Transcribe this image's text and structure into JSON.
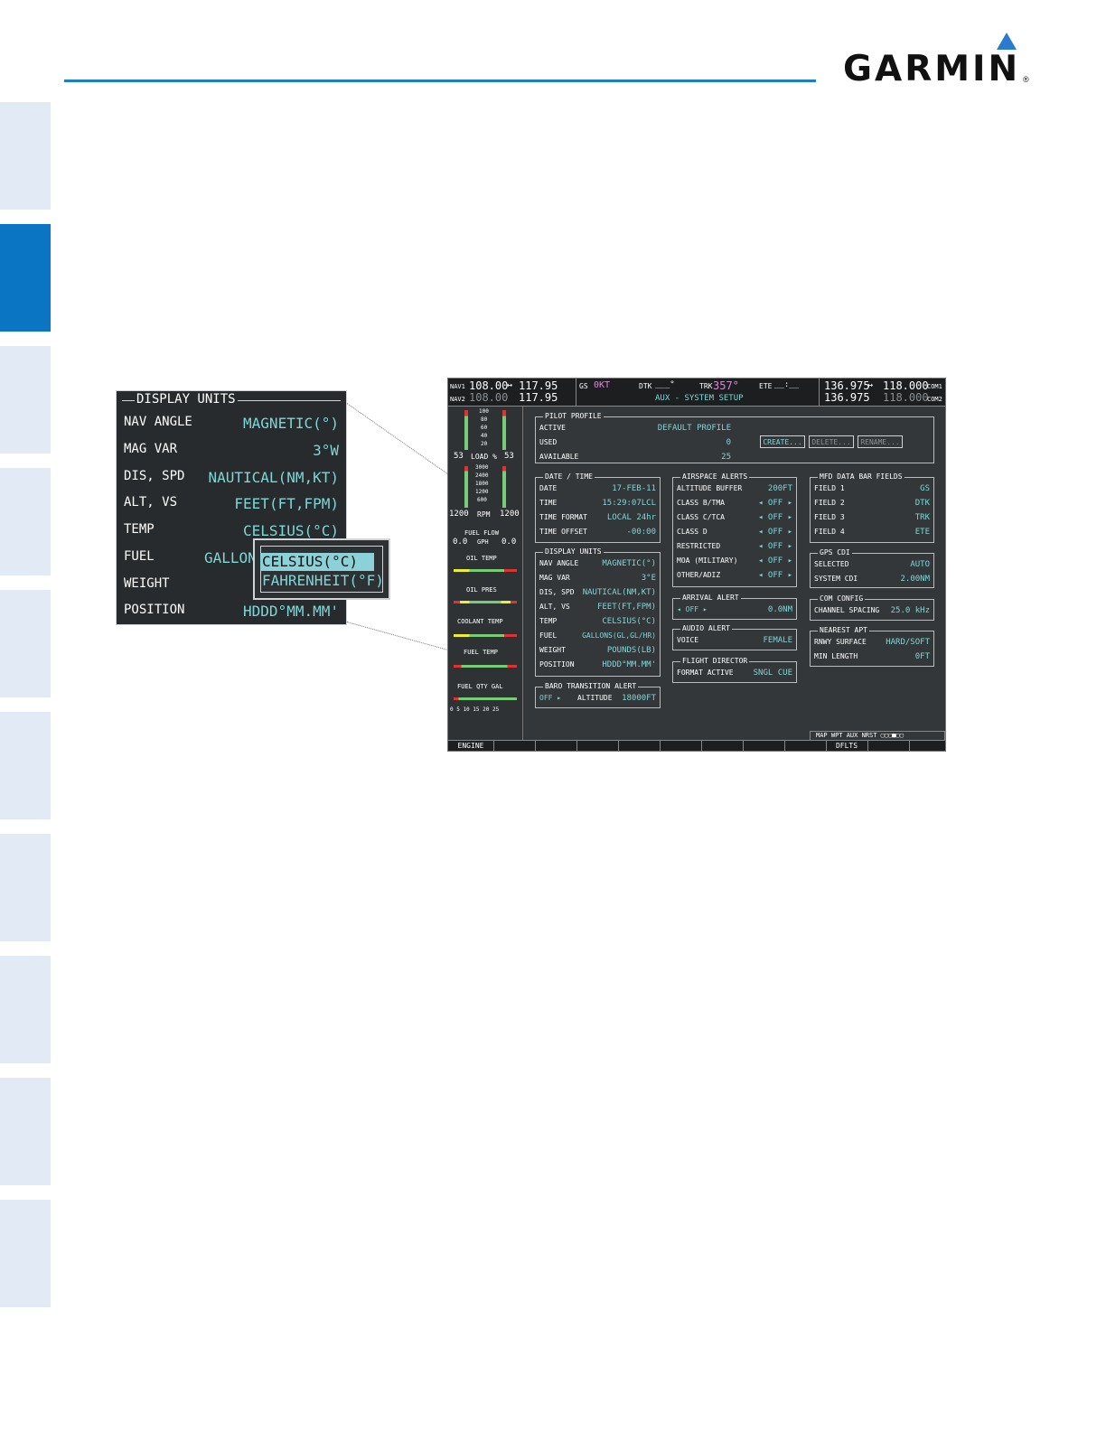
{
  "brand": {
    "name": "GARMIN",
    "reg": "®"
  },
  "zoom": {
    "title": "DISPLAY UNITS",
    "rows": [
      {
        "label": "NAV ANGLE",
        "value": "MAGNETIC(°)"
      },
      {
        "label": "MAG VAR",
        "value": "3°W"
      },
      {
        "label": "DIS, SPD",
        "value": "NAUTICAL(NM,KT)"
      },
      {
        "label": "ALT, VS",
        "value": "FEET(FT,FPM)"
      },
      {
        "label": "TEMP",
        "value": "CELSIUS(°C)"
      },
      {
        "label": "FUEL",
        "value": "GALLON"
      },
      {
        "label": "WEIGHT",
        "value": ""
      },
      {
        "label": "POSITION",
        "value": "HDDD°MM.MM'"
      }
    ],
    "popup": {
      "selected": "CELSIUS(°C)",
      "other": "FAHRENHEIT(°F)"
    }
  },
  "mfd": {
    "topbar": {
      "nav1_label": "NAV1",
      "nav1_active": "108.00",
      "nav1_standby": "117.95",
      "nav2_label": "NAV2",
      "nav2_active": "108.00",
      "nav2_standby": "117.95",
      "gs_label": "GS",
      "gs_value": "0KT",
      "dtk_label": "DTK",
      "dtk_value": "___°",
      "trk_label": "TRK",
      "trk_value": "357°",
      "ete_label": "ETE",
      "ete_value": "__:__",
      "page_title": "AUX - SYSTEM SETUP",
      "com1_standby": "136.975",
      "com1_active": "118.000",
      "com1_label": "COM1",
      "com2_standby": "136.975",
      "com2_active": "118.000",
      "com2_label": "COM2",
      "swap_glyph": "↔"
    },
    "eis": {
      "load_ticks": [
        "100",
        "80",
        "60",
        "40",
        "20"
      ],
      "load_label": "LOAD %",
      "load_left": "53",
      "load_right": "53",
      "rpm_ticks": [
        "3000",
        "2400",
        "1800",
        "1200",
        "600"
      ],
      "rpm_label": "RPM",
      "rpm_left": "1200",
      "rpm_right": "1200",
      "fuel_flow_label": "FUEL FLOW",
      "fuel_flow_unit": "GPH",
      "fuel_flow_left": "0.0",
      "fuel_flow_right": "0.0",
      "oil_temp": "OIL TEMP",
      "oil_pres": "OIL PRES",
      "coolant_temp": "COOLANT TEMP",
      "fuel_temp": "FUEL TEMP",
      "fuel_qty": "FUEL QTY GAL",
      "fuel_qty_scale": "0  5  10  15  20  25"
    },
    "pilot_profile": {
      "title": "PILOT PROFILE",
      "active_label": "ACTIVE",
      "active_value": "DEFAULT PROFILE",
      "used_label": "USED",
      "used_value": "0",
      "available_label": "AVAILABLE",
      "available_value": "25",
      "create": "CREATE...",
      "delete": "DELETE...",
      "rename": "RENAME..."
    },
    "date_time": {
      "title": "DATE / TIME",
      "rows": [
        {
          "label": "DATE",
          "value": "17-FEB-11"
        },
        {
          "label": "TIME",
          "value": "15:29:07LCL"
        },
        {
          "label": "TIME FORMAT",
          "value": "LOCAL 24hr"
        },
        {
          "label": "TIME OFFSET",
          "value": "-00:00"
        }
      ]
    },
    "display_units": {
      "title": "DISPLAY UNITS",
      "rows": [
        {
          "label": "NAV ANGLE",
          "value": "MAGNETIC(°)"
        },
        {
          "label": "MAG VAR",
          "value": "3°E"
        },
        {
          "label": "DIS, SPD",
          "value": "NAUTICAL(NM,KT)"
        },
        {
          "label": "ALT, VS",
          "value": "FEET(FT,FPM)"
        },
        {
          "label": "TEMP",
          "value": "CELSIUS(°C)"
        },
        {
          "label": "FUEL",
          "value": "GALLONS(GL,GL/HR)"
        },
        {
          "label": "WEIGHT",
          "value": "POUNDS(LB)"
        },
        {
          "label": "POSITION",
          "value": "HDDD°MM.MM'"
        }
      ]
    },
    "baro": {
      "title": "BARO TRANSITION ALERT",
      "state": "OFF ▸",
      "label": "ALTITUDE",
      "value": "18000FT"
    },
    "airspace": {
      "title": "AIRSPACE ALERTS",
      "rows": [
        {
          "label": "ALTITUDE BUFFER",
          "value": "200FT"
        },
        {
          "label": "CLASS B/TMA",
          "value": "◂ OFF ▸"
        },
        {
          "label": "CLASS C/TCA",
          "value": "◂ OFF ▸"
        },
        {
          "label": "CLASS D",
          "value": "◂ OFF ▸"
        },
        {
          "label": "RESTRICTED",
          "value": "◂ OFF ▸"
        },
        {
          "label": "MOA (MILITARY)",
          "value": "◂ OFF ▸"
        },
        {
          "label": "OTHER/ADIZ",
          "value": "◂ OFF ▸"
        }
      ]
    },
    "arrival": {
      "title": "ARRIVAL ALERT",
      "state": "◂ OFF ▸",
      "value": "0.0NM"
    },
    "audio": {
      "title": "AUDIO ALERT",
      "label": "VOICE",
      "value": "FEMALE"
    },
    "flight_director": {
      "title": "FLIGHT DIRECTOR",
      "label": "FORMAT ACTIVE",
      "value": "SNGL CUE"
    },
    "mfd_fields": {
      "title": "MFD DATA BAR FIELDS",
      "rows": [
        {
          "label": "FIELD 1",
          "value": "GS"
        },
        {
          "label": "FIELD 2",
          "value": "DTK"
        },
        {
          "label": "FIELD 3",
          "value": "TRK"
        },
        {
          "label": "FIELD 4",
          "value": "ETE"
        }
      ]
    },
    "gps_cdi": {
      "title": "GPS CDI",
      "rows": [
        {
          "label": "SELECTED",
          "value": "AUTO"
        },
        {
          "label": "SYSTEM CDI",
          "value": "2.00NM"
        }
      ]
    },
    "com_config": {
      "title": "COM CONFIG",
      "label": "CHANNEL SPACING",
      "value": "25.0 kHz"
    },
    "nearest_apt": {
      "title": "NEAREST APT",
      "rows": [
        {
          "label": "RNWY SURFACE",
          "value": "HARD/SOFT"
        },
        {
          "label": "MIN LENGTH",
          "value": "0FT"
        }
      ]
    },
    "page_group": "MAP WPT AUX NRST ▢▢▢■▢▢",
    "softkeys": {
      "engine": "ENGINE",
      "dflts": "DFLTS"
    }
  }
}
